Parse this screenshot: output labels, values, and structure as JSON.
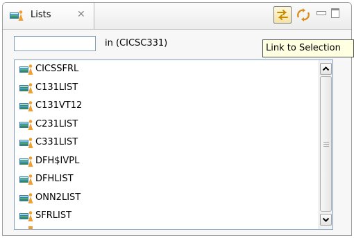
{
  "view": {
    "tab_label": "Lists",
    "tab_icon": "list-icon",
    "close_icon": "close-icon",
    "toolbar": {
      "link_icon": "link-to-selection-icon",
      "sync_icon": "sync-icon",
      "minimize_icon": "minimize-icon",
      "maximize_icon": "maximize-icon"
    }
  },
  "filter": {
    "value": "",
    "scope_label": "in (CICSC331)"
  },
  "tooltip": {
    "text": "Link to Selection"
  },
  "list": {
    "items": [
      {
        "label": "CICSSFRL"
      },
      {
        "label": "C131LIST"
      },
      {
        "label": "C131VT12"
      },
      {
        "label": "C231LIST"
      },
      {
        "label": "C331LIST"
      },
      {
        "label": "DFH$IVPL"
      },
      {
        "label": "DFHLIST"
      },
      {
        "label": "ONN2LIST"
      },
      {
        "label": "SFRLIST"
      }
    ],
    "item_icon": "list-icon"
  },
  "colors": {
    "accent": "#3a8a3a",
    "icon_book": "#2f7fbf",
    "icon_person": "#f0a030",
    "tooltip_bg": "#ffffe1"
  }
}
